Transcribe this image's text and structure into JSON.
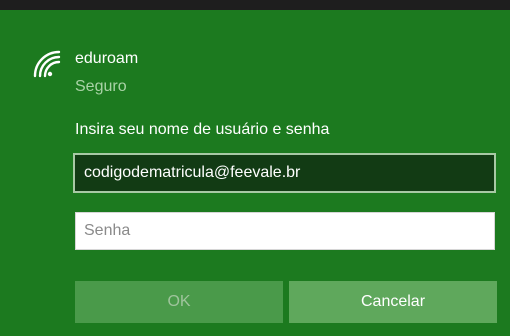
{
  "network": {
    "name": "eduroam",
    "status": "Seguro",
    "icon": "wifi-secured-icon"
  },
  "login": {
    "prompt": "Insira seu nome de usuário e senha",
    "username_value": "codigodematricula@feevale.br",
    "password_placeholder": "Senha"
  },
  "buttons": {
    "ok_label": "OK",
    "cancel_label": "Cancelar"
  },
  "colors": {
    "panel_background": "#1c7a1f",
    "top_strip": "#1e1e1e",
    "username_field_background": "#123b14",
    "ok_button_background": "#4a9a4a",
    "cancel_button_background": "#5fa85c"
  }
}
